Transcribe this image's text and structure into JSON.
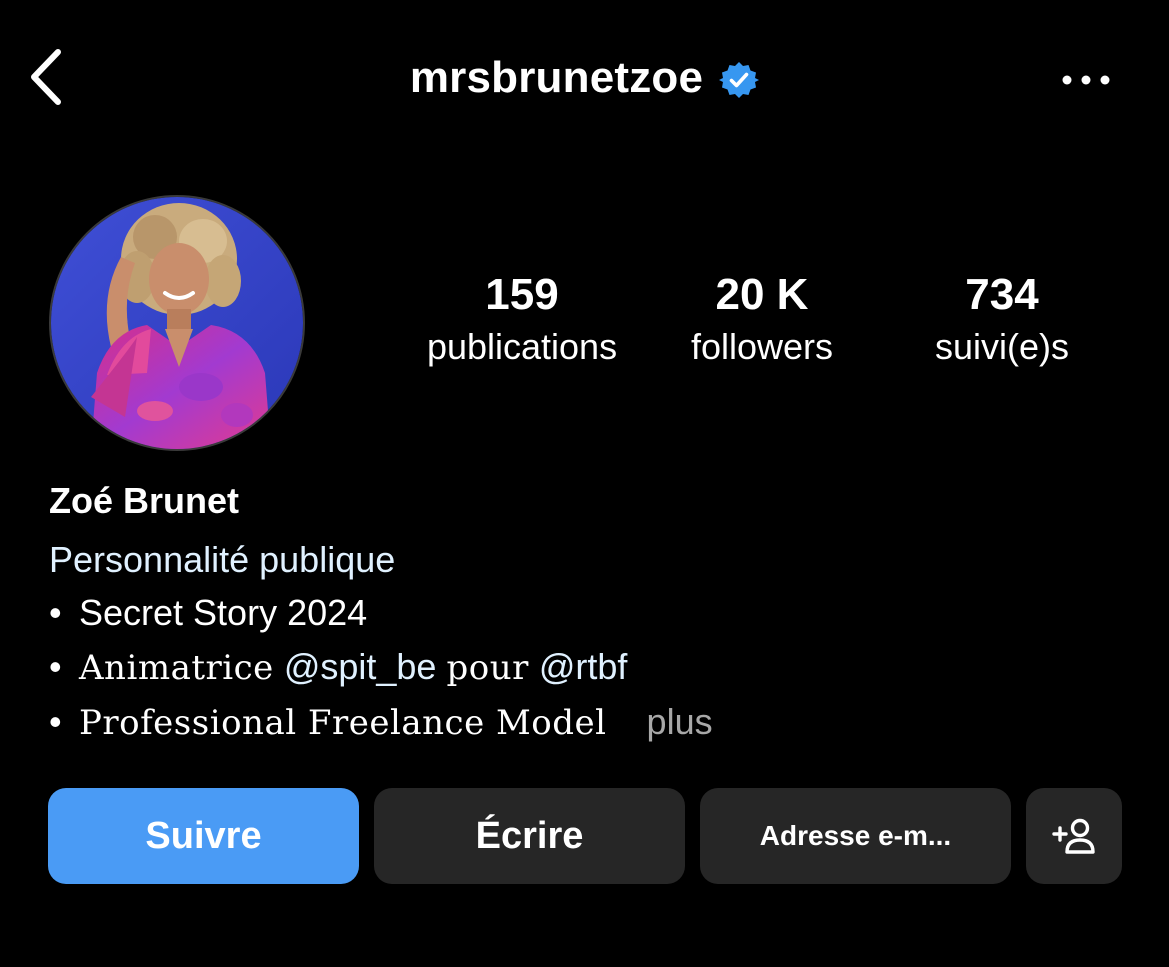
{
  "header": {
    "username": "mrsbrunetzoe",
    "back_icon": "chevron-left-icon",
    "verified_icon": "verified-badge-icon",
    "more_icon": "ellipsis-icon"
  },
  "profile": {
    "avatar_alt": "profile-photo",
    "stats": {
      "posts_count": "159",
      "posts_label": "publications",
      "followers_count": "20 K",
      "followers_label": "followers",
      "following_count": "734",
      "following_label": "suivi(e)s"
    }
  },
  "bio": {
    "full_name": "Zoé Brunet",
    "category": "Personnalité publique",
    "line1_bullet": "•",
    "line1_text": "Secret Story 2024",
    "line2_bullet": "•",
    "line2_text_a": "Animatrice",
    "line2_mention_a": "@spit_be",
    "line2_text_b": "pour",
    "line2_mention_b": "@rtbf",
    "line3_bullet": "•",
    "line3_text": "Professional Freelance Model",
    "more_label": "plus"
  },
  "actions": {
    "follow_label": "Suivre",
    "message_label": "Écrire",
    "email_label": "Adresse e-m...",
    "suggest_icon": "add-person-icon"
  },
  "colors": {
    "background": "#000000",
    "accent_blue": "#4a9bf5",
    "verified_blue": "#3797f0",
    "button_gray": "#262626",
    "link_text": "#e0f1ff",
    "muted_text": "#a8a8a8"
  }
}
